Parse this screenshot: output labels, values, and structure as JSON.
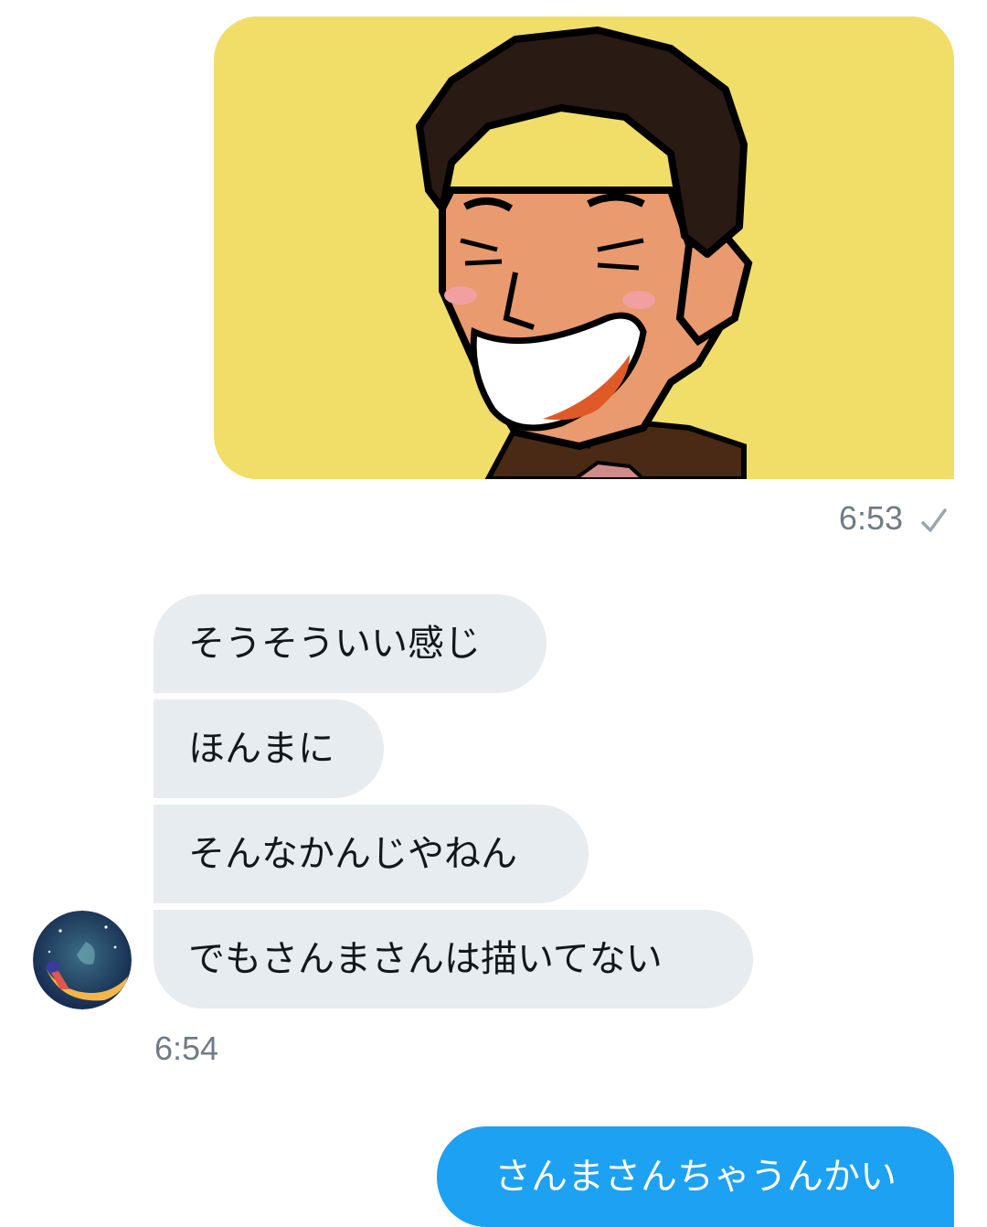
{
  "conversation": {
    "sent_image": {
      "icon": "cartoon-laughing-man-image"
    },
    "sent_time": "6:53",
    "received": {
      "messages": [
        "そうそういい感じ",
        "ほんまに",
        "そんなかんじやねん",
        "でもさんまさんは描いてない"
      ],
      "time": "6:54",
      "avatar_icon": "moon-girl-avatar"
    },
    "sent_text": "さんまさんちゃうんかい"
  },
  "colors": {
    "sent_bubble": "#1da1f2",
    "received_bubble": "#e6ecf0",
    "timestamp": "#6f7c87",
    "image_background": "#f1de69"
  }
}
